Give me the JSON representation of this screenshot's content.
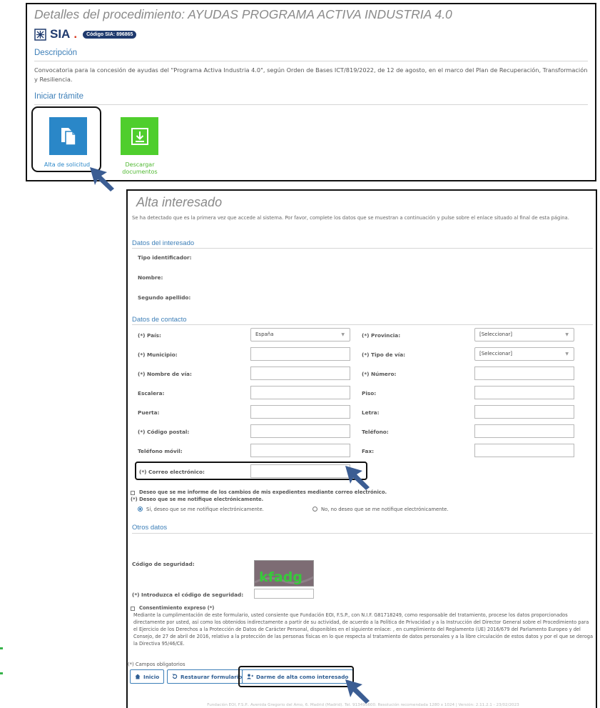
{
  "procedure": {
    "title": "Detalles del procedimiento: AYUDAS PROGRAMA ACTIVA INDUSTRIA 4.0",
    "sia_text": "SIA",
    "sia_badge": "Código SIA: 896865",
    "description_heading": "Descripción",
    "description": "Convocatoria para la concesión de ayudas del \"Programa Activa Industria 4.0\", según Orden de Bases ICT/819/2022, de 12 de agosto, en el marco del Plan de Recuperación, Transformación y Resiliencia.",
    "start_heading": "Iniciar trámite",
    "tiles": {
      "alta_label": "Alta de solicitud",
      "descargar_label": "Descargar documentos"
    }
  },
  "form": {
    "title": "Alta interesado",
    "intro": "Se ha detectado que es la primera vez que accede al sistema. Por favor, complete los datos que se muestran a continuación y pulse sobre el enlace situado al final de esta página.",
    "interested_heading": "Datos del interesado",
    "interested": {
      "tipo_identificador": "Tipo identificador:",
      "nombre": "Nombre:",
      "segundo_apellido": "Segundo apellido:"
    },
    "contact_heading": "Datos de contacto",
    "contact": {
      "pais_label": "(*) País:",
      "pais_value": "España",
      "provincia_label": "(*) Provincia:",
      "provincia_value": "[Seleccionar]",
      "municipio_label": "(*) Municipio:",
      "tipo_via_label": "(*) Tipo de vía:",
      "tipo_via_value": "[Seleccionar]",
      "nombre_via_label": "(*) Nombre de vía:",
      "numero_label": "(*) Número:",
      "escalera_label": "Escalera:",
      "piso_label": "Piso:",
      "puerta_label": "Puerta:",
      "letra_label": "Letra:",
      "cp_label": "(*) Código postal:",
      "telefono_label": "Teléfono:",
      "movil_label": "Teléfono móvil:",
      "fax_label": "Fax:",
      "email_label": "(*) Correo electrónico:"
    },
    "notify_changes": "Deseo que se me informe de los cambios de mis expedientes mediante correo electrónico.",
    "notify_question": "(*) Deseo que se me notifique electrónicamente.",
    "notify_yes": "Sí, deseo que se me notifique electrónicamente.",
    "notify_no": "No, no deseo que se me notifique electrónicamente.",
    "other_heading": "Otros datos",
    "security_code_label": "Código de seguridad:",
    "captcha_text": "kfadg",
    "enter_code_label": "(*) Introduzca el código de seguridad:",
    "consent_label": "Consentimiento expreso (*)",
    "consent_text": "Mediante la cumplimentación de este formulario, usted consiente que Fundación EOI, F.S.P., con N.I.F. G81718249, como responsable del tratamiento, procese los datos proporcionados directamente por usted, así como los obtenidos indirectamente a partir de su actividad, de acuerdo a la Política de Privacidad y a la Instrucción del Director General sobre el Procedimiento para el Ejercicio de los Derechos a la Protección de Datos de Carácter Personal, disponibles en el siguiente enlace: , en cumplimiento del Reglamento (UE) 2016/679 del Parlamento Europeo y del Consejo, de 27 de abril de 2016, relativo a la protección de las personas físicas en lo que respecta al tratamiento de datos personales y a la libre circulación de estos datos y por el que se deroga la Directiva 95/46/CE.",
    "required_note": "(*) Campos obligatorios",
    "buttons": {
      "inicio": "Inicio",
      "restaurar": "Restaurar formulario",
      "alta": "Darme de alta como interesado"
    },
    "footer": "Fundación EOI, F.S.P.. Avenida Gregorio del Amo, 6. Madrid (Madrid). Tel. 913495600. Resolución recomendada 1280 x 1024 | Versión: 2.11.2.1 - 23/02/2023"
  },
  "colors": {
    "accent_blue": "#3d7fb8",
    "tile_blue": "#2a87c8",
    "tile_green": "#4fce2d",
    "arrow": "#3b5d93"
  },
  "icons": [
    "document-copy-icon",
    "download-icon",
    "home-icon",
    "restore-icon",
    "add-user-icon",
    "pointer-arrow-icon"
  ]
}
